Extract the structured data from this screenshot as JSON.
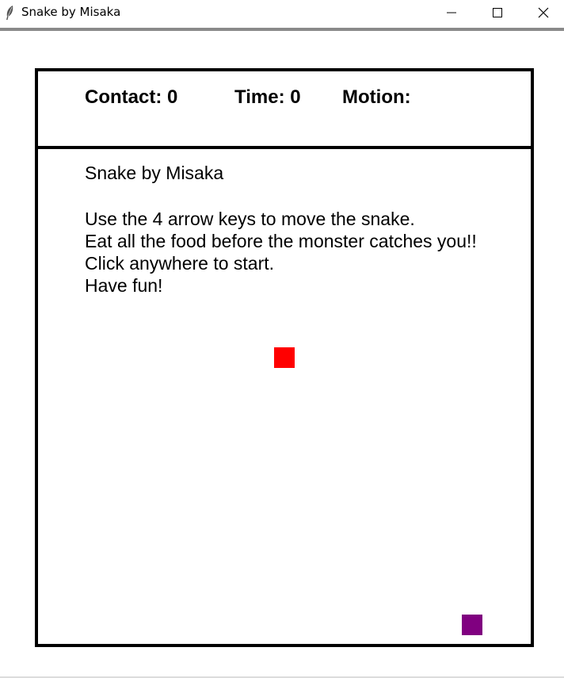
{
  "window": {
    "title": "Snake by Misaka",
    "icon": "feather-icon",
    "controls": [
      "minimize-icon",
      "maximize-icon",
      "close-icon"
    ]
  },
  "hud": {
    "contact": "Contact: 0",
    "time": "Time: 0",
    "motion": "Motion:"
  },
  "intro": {
    "title": "Snake by Misaka",
    "lines": [
      "Use the 4 arrow keys to move the snake.",
      "Eat all the food before the monster catches you!!",
      "Click anywhere to start.",
      "Have fun!"
    ]
  },
  "colors": {
    "food": "#ff0000",
    "monster": "#800080",
    "border": "#000000"
  }
}
